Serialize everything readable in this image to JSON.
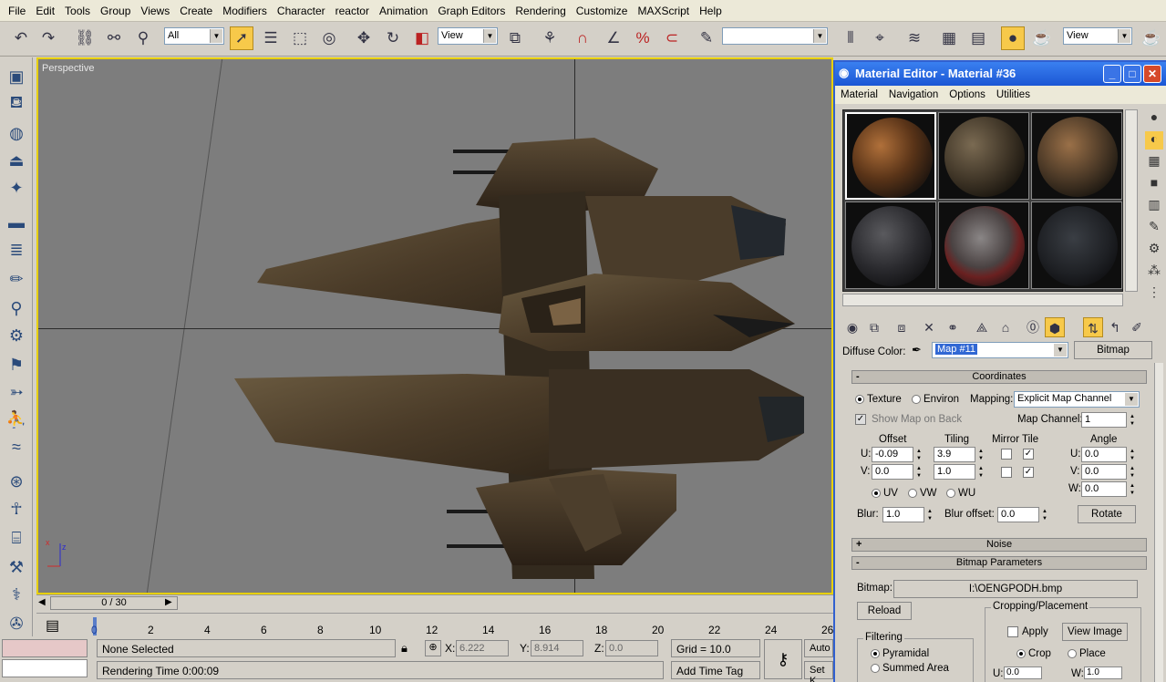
{
  "menubar": {
    "items": [
      "File",
      "Edit",
      "Tools",
      "Group",
      "Views",
      "Create",
      "Modifiers",
      "Character",
      "reactor",
      "Animation",
      "Graph Editors",
      "Rendering",
      "Customize",
      "MAXScript",
      "Help"
    ]
  },
  "toolbar": {
    "selection_filter": "All",
    "ref_coord": "View",
    "named_selection": "",
    "render_view": "View"
  },
  "viewport": {
    "label": "Perspective",
    "axis_x": "x",
    "axis_z": "z"
  },
  "timeslider": {
    "frame": "0 / 30",
    "ticks": [
      "0",
      "2",
      "4",
      "6",
      "8",
      "10",
      "12",
      "14",
      "16",
      "18",
      "20",
      "22",
      "24",
      "26"
    ]
  },
  "status": {
    "selection": "None Selected",
    "prompt": "Rendering Time  0:00:09",
    "x_label": "X:",
    "x_value": "6.222",
    "y_label": "Y:",
    "y_value": "8.914",
    "z_label": "Z:",
    "z_value": "0.0",
    "grid": "Grid = 10.0",
    "add_time_tag": "Add Time Tag",
    "auto": "Auto",
    "set_key": "Set K"
  },
  "material_editor": {
    "title": "Material Editor - Material #36",
    "menu": [
      "Material",
      "Navigation",
      "Options",
      "Utilities"
    ],
    "diffuse_label": "Diffuse Color:",
    "map_name": "Map #11",
    "map_type": "Bitmap",
    "coordinates": {
      "header": "Coordinates",
      "texture": "Texture",
      "environ": "Environ",
      "mapping_label": "Mapping:",
      "mapping_value": "Explicit Map Channel",
      "show_map_on_back": "Show Map on Back",
      "map_channel_label": "Map Channel:",
      "map_channel": "1",
      "offset_label": "Offset",
      "tiling_label": "Tiling",
      "mirror_tile_label": "Mirror Tile",
      "angle_label": "Angle",
      "u_label": "U:",
      "v_label": "V:",
      "w_label": "W:",
      "u_offset": "-0.09",
      "v_offset": "0.0",
      "u_tiling": "3.9",
      "v_tiling": "1.0",
      "u_angle": "0.0",
      "v_angle": "0.0",
      "w_angle": "0.0",
      "uv": "UV",
      "vw": "VW",
      "wu": "WU",
      "blur_label": "Blur:",
      "blur": "1.0",
      "blur_offset_label": "Blur offset:",
      "blur_offset": "0.0",
      "rotate": "Rotate"
    },
    "noise_header": "Noise",
    "bitmap_params": {
      "header": "Bitmap Parameters",
      "bitmap_label": "Bitmap:",
      "bitmap_path": "I:\\OENGPODH.bmp",
      "reload": "Reload",
      "cropping_label": "Cropping/Placement",
      "apply": "Apply",
      "view_image": "View Image",
      "crop": "Crop",
      "place": "Place",
      "filtering_label": "Filtering",
      "pyramidal": "Pyramidal",
      "summed_area": "Summed Area",
      "u_val": "0.0",
      "w_val": "1.0",
      "u_label": "U:",
      "w_label": "W:"
    }
  }
}
